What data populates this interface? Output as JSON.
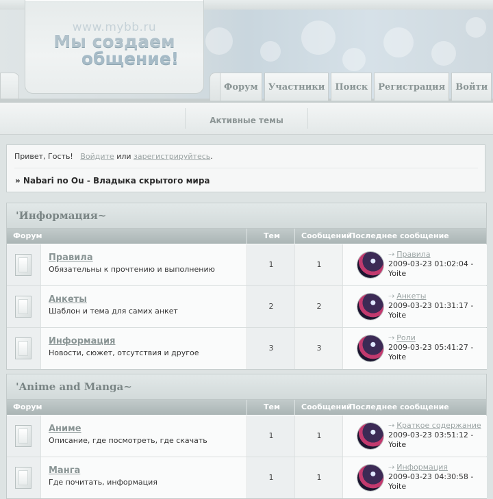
{
  "header": {
    "logo_url": "www.mybb.ru",
    "logo_line1": "Мы создаем",
    "logo_line2": "общение!",
    "nav": [
      "Форум",
      "Участники",
      "Поиск",
      "Регистрация",
      "Войти"
    ]
  },
  "subnav": {
    "active_topics": "Активные темы"
  },
  "welcome": {
    "greeting": "Привет, Гость!",
    "login": "Войдите",
    "or": "или",
    "register": "зарегистрируйтесь",
    "period": ".",
    "breadcrumb": "» Nabari no Ou - Владыка скрытого мира"
  },
  "columns": {
    "forum": "Форум",
    "topics": "Тем",
    "posts": "Сообщений",
    "last_post": "Последнее сообщение"
  },
  "categories": [
    {
      "title": "'Информация~",
      "forums": [
        {
          "name": "Правила",
          "desc": "Обязательны к прочтению и выполнению",
          "topics": "1",
          "posts": "1",
          "last_topic": "Правила",
          "last_date": "2009-03-23 01:02:04 -",
          "last_user": "Yoite"
        },
        {
          "name": "Анкеты",
          "desc": "Шаблон и тема для самих анкет",
          "topics": "2",
          "posts": "2",
          "last_topic": "Анкеты",
          "last_date": "2009-03-23 01:31:17 -",
          "last_user": "Yoite"
        },
        {
          "name": "Информация",
          "desc": "Новости, сюжет, отсутствия и другое",
          "topics": "3",
          "posts": "3",
          "last_topic": "Роли",
          "last_date": "2009-03-23 05:41:27 -",
          "last_user": "Yoite"
        }
      ]
    },
    {
      "title": "'Anime and Manga~",
      "forums": [
        {
          "name": "Аниме",
          "desc": "Описание, где посмотреть, где скачать",
          "topics": "1",
          "posts": "1",
          "last_topic": "Краткое содержание",
          "last_date": "2009-03-23 03:51:12 -",
          "last_user": "Yoite"
        },
        {
          "name": "Манга",
          "desc": "Где почитать, информация",
          "topics": "1",
          "posts": "1",
          "last_topic": "Информация",
          "last_date": "2009-03-23 04:30:58 -",
          "last_user": "Yoite"
        }
      ]
    }
  ],
  "icons": {
    "forum": "forum-read-icon",
    "avatar": "user-avatar",
    "arrow": "go-to-post-arrow-icon"
  }
}
